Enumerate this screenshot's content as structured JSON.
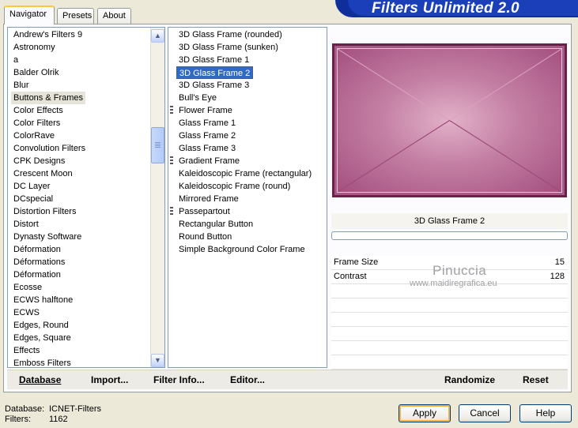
{
  "banner": {
    "title": "Filters Unlimited 2.0"
  },
  "tabs": [
    "Navigator",
    "Presets",
    "About"
  ],
  "categories": {
    "items": [
      "Andrew's Filters 9",
      "Astronomy",
      "a",
      "Balder Olrik",
      "Blur",
      "Buttons & Frames",
      "Color Effects",
      "Color Filters",
      "ColorRave",
      "Convolution Filters",
      "CPK Designs",
      "Crescent Moon",
      "DC Layer",
      "DCspecial",
      "Distortion Filters",
      "Distort",
      "Dynasty Software",
      "Déformation",
      "Déformations",
      "Déformation",
      "Ecosse",
      "ECWS halftone",
      "ECWS",
      "Edges, Round",
      "Edges, Square",
      "Effects",
      "Emboss Filters"
    ],
    "selected": "Buttons & Frames"
  },
  "filters": {
    "items": [
      "3D Glass Frame (rounded)",
      "3D Glass Frame (sunken)",
      "3D Glass Frame 1",
      "3D Glass Frame 2",
      "3D Glass Frame 3",
      "Bull's Eye",
      "Flower Frame",
      "Glass Frame 1",
      "Glass Frame 2",
      "Glass Frame 3",
      "Gradient Frame",
      "Kaleidoscopic Frame (rectangular)",
      "Kaleidoscopic Frame (round)",
      "Mirrored Frame",
      "Passepartout",
      "Rectangular Button",
      "Round Button",
      "Simple Background Color Frame"
    ],
    "selected": "3D Glass Frame 2",
    "marked": [
      "Flower Frame",
      "Gradient Frame",
      "Passepartout"
    ]
  },
  "preview": {
    "filter_title": "3D Glass Frame 2"
  },
  "params": [
    {
      "name": "Frame Size",
      "value": "15"
    },
    {
      "name": "Contrast",
      "value": "128"
    }
  ],
  "watermark": {
    "name": "Pinuccia",
    "url": "www.maidiregrafica.eu"
  },
  "toolbar": {
    "database": "Database",
    "import": "Import...",
    "filter_info": "Filter Info...",
    "editor": "Editor...",
    "randomize": "Randomize",
    "reset": "Reset"
  },
  "status": {
    "database_label": "Database:",
    "database_value": "ICNET-Filters",
    "filters_label": "Filters:",
    "filters_value": "1162"
  },
  "buttons": {
    "apply": "Apply",
    "cancel": "Cancel",
    "help": "Help"
  }
}
